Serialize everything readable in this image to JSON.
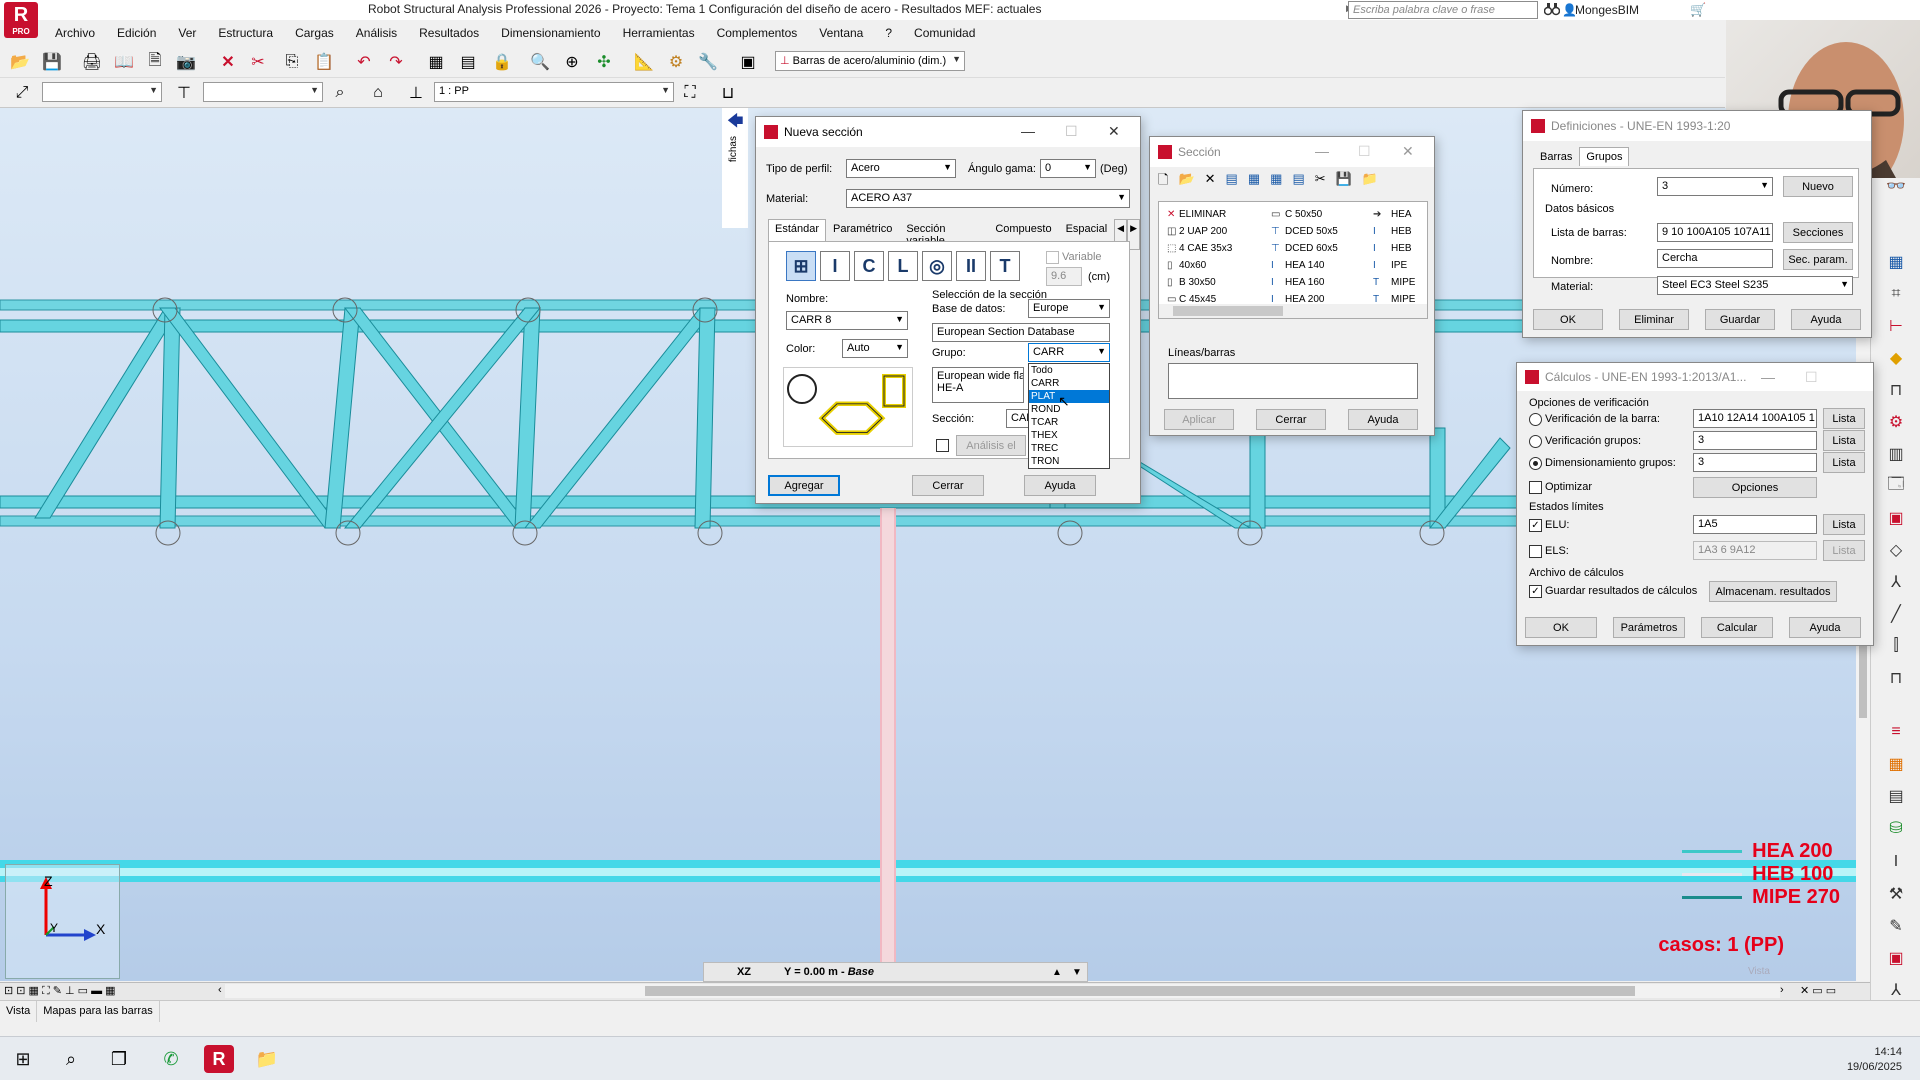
{
  "app": {
    "title": "Robot Structural Analysis Professional 2026 - Proyecto: Tema 1  Configuración del diseño de acero  - Resultados MEF: actuales",
    "logo_text": "R",
    "logo_sub": "PRO",
    "search_placeholder": "Escriba palabra clave o frase",
    "user": "MongesBIM"
  },
  "menu": [
    "Archivo",
    "Edición",
    "Ver",
    "Estructura",
    "Cargas",
    "Análisis",
    "Resultados",
    "Dimensionamiento",
    "Herramientas",
    "Complementos",
    "Ventana",
    "?",
    "Comunidad"
  ],
  "toolbar": {
    "bar_type_combo": "Barras de acero/aluminio (dim.)",
    "case_combo": "1 : PP"
  },
  "viewport": {
    "plane": "XZ",
    "coord": "Y = 0.00 m - ",
    "coord_italic": "Base",
    "legend": [
      {
        "label": "HEA 200",
        "color": "#3cc8c8"
      },
      {
        "label": "HEB 100",
        "color": "#e8e8f0"
      },
      {
        "label": "MIPE 270",
        "color": "#1a8c8c"
      }
    ],
    "cases": "casos: 1 (PP)",
    "vista": "Vista",
    "axis_z": "Z",
    "axis_x": "X",
    "axis_y": "Y",
    "fichas": "fichas"
  },
  "status_tabs": [
    "Vista",
    "Mapas para las barras"
  ],
  "clock": {
    "time": "14:14",
    "date": "19/06/2025"
  },
  "nueva_seccion": {
    "title": "Nueva sección",
    "tipo_perfil_label": "Tipo de perfil:",
    "tipo_perfil": "Acero",
    "angulo_label": "Ángulo gama:",
    "angulo": "0",
    "deg": "(Deg)",
    "material_label": "Material:",
    "material": "ACERO A37",
    "tabs": [
      "Estándar",
      "Paramétrico",
      "Sección variable",
      "Compuesto",
      "Espacial"
    ],
    "variable_label": "Variable",
    "variable_value": "9.6",
    "cm": "(cm)",
    "nombre_label": "Nombre:",
    "nombre": "CARR 8",
    "color_label": "Color:",
    "color": "Auto",
    "seleccion_label": "Selección de la sección",
    "base_datos_label": "Base de datos:",
    "base_datos": "Europe",
    "db_desc": "European Section Database",
    "grupo_label": "Grupo:",
    "grupo": "CARR",
    "grupo_options": [
      "Todo",
      "CARR",
      "PLAT",
      "ROND",
      "TCAR",
      "THEX",
      "TREC",
      "TRON"
    ],
    "grupo_selected_index": 2,
    "desc_line1": "European wide flan",
    "desc_line2": "HE-A",
    "seccion_label": "Sección:",
    "seccion": "CARR",
    "analisis_label": "Análisis el",
    "agregar": "Agregar",
    "cerrar": "Cerrar",
    "ayuda": "Ayuda"
  },
  "seccion": {
    "title": "Sección",
    "col1": [
      "ELIMINAR",
      "2 UAP 200",
      "4 CAE 35x3",
      "40x60",
      "B 30x50",
      "C 45x45"
    ],
    "col2": [
      "C 50x50",
      "DCED 50x5",
      "DCED 60x5",
      "HEA 140",
      "HEA 160",
      "HEA 200"
    ],
    "col3": [
      "HEA",
      "HEB",
      "HEB",
      "IPE",
      "MIPE",
      "MIPE"
    ],
    "lineas_label": "Líneas/barras",
    "aplicar": "Aplicar",
    "cerrar": "Cerrar",
    "ayuda": "Ayuda"
  },
  "definiciones": {
    "title": "Definiciones - UNE-EN 1993-1:20",
    "tabs": [
      "Barras",
      "Grupos"
    ],
    "numero_label": "Número:",
    "numero": "3",
    "nuevo": "Nuevo",
    "datos_basicos": "Datos básicos",
    "lista_barras_label": "Lista de barras:",
    "lista_barras": "9 10 100A105 107A11",
    "secciones": "Secciones",
    "nombre_label": "Nombre:",
    "nombre": "Cercha",
    "sec_param": "Sec. param.",
    "material_label": "Material:",
    "material": "Steel EC3 Steel S235",
    "ok": "OK",
    "eliminar": "Eliminar",
    "guardar": "Guardar",
    "ayuda": "Ayuda"
  },
  "calculos": {
    "title": "Cálculos - UNE-EN 1993-1:2013/A1...",
    "opciones_label": "Opciones de verificación",
    "verif_barra_label": "Verificación de la barra:",
    "verif_barra": "1A10 12A14 100A105 1",
    "verif_grupos_label": "Verificación grupos:",
    "verif_grupos": "3",
    "dim_grupos_label": "Dimensionamiento grupos:",
    "dim_grupos": "3",
    "lista": "Lista",
    "optimizar_label": "Optimizar",
    "opciones": "Opciones",
    "estados_label": "Estados límites",
    "elu_label": "ELU:",
    "elu": "1A5",
    "els_label": "ELS:",
    "els": "1A3 6 9A12",
    "archivo_label": "Archivo de cálculos",
    "guardar_label": "Guardar resultados de cálculos",
    "almacenam": "Almacenam. resultados",
    "ok": "OK",
    "parametros": "Parámetros",
    "calcular": "Calcular",
    "ayuda": "Ayuda"
  }
}
